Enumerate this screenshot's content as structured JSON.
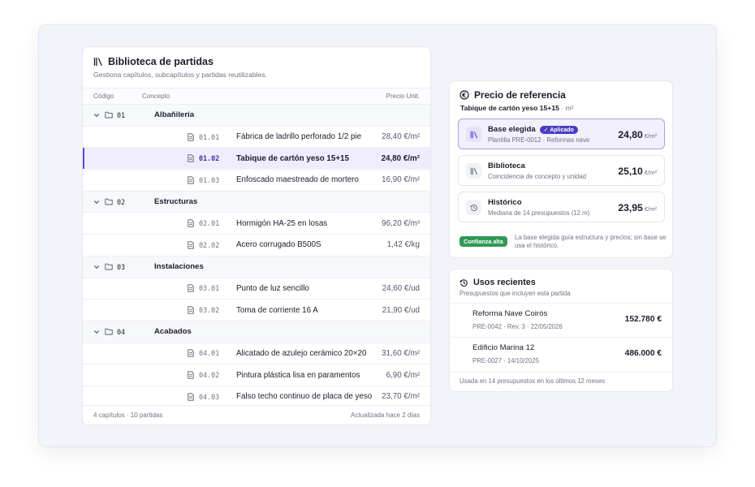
{
  "library": {
    "title": "Biblioteca de partidas",
    "subtitle": "Gestiona capítulos, subcapítulos y partidas reutilizables.",
    "columns": {
      "code": "Código",
      "concept": "Concepto",
      "price": "Precio Unit."
    },
    "chapters": [
      {
        "code": "01",
        "name": "Albañilería",
        "items": [
          {
            "code": "01.01",
            "name": "Fábrica de ladrillo perforado 1/2 pie",
            "price": "28,40 €/m²"
          },
          {
            "code": "01.02",
            "name": "Tabique de cartón yeso 15+15",
            "price": "24,80 €/m²"
          },
          {
            "code": "01.03",
            "name": "Enfoscado maestreado de mortero",
            "price": "16,90 €/m²"
          }
        ]
      },
      {
        "code": "02",
        "name": "Estructuras",
        "items": [
          {
            "code": "02.01",
            "name": "Hormigón HA-25 en losas",
            "price": "96,20 €/m³"
          },
          {
            "code": "02.02",
            "name": "Acero corrugado B500S",
            "price": "1,42 €/kg"
          }
        ]
      },
      {
        "code": "03",
        "name": "Instalaciones",
        "items": [
          {
            "code": "03.01",
            "name": "Punto de luz sencillo",
            "price": "24,60 €/ud"
          },
          {
            "code": "03.02",
            "name": "Toma de corriente 16 A",
            "price": "21,90 €/ud"
          }
        ]
      },
      {
        "code": "04",
        "name": "Acabados",
        "items": [
          {
            "code": "04.01",
            "name": "Alicatado de azulejo cerámico 20×20",
            "price": "31,60 €/m²"
          },
          {
            "code": "04.02",
            "name": "Pintura plástica lisa en paramentos",
            "price": "6,90 €/m²"
          },
          {
            "code": "04.03",
            "name": "Falso techo continuo de placa de yeso",
            "price": "23,70 €/m²"
          }
        ]
      }
    ],
    "footer_left": "4 capítulos · 10 partidas",
    "footer_right": "Actualizada hace 2 días"
  },
  "reference": {
    "title": "Precio de referencia",
    "item": "Tabique de cartón yeso 15+15",
    "unit": "· m²",
    "options": [
      {
        "name": "Base elegida",
        "badge": "✓ Aplicado",
        "desc": "Plantilla PRE-0012 · Reformas nave",
        "price": "24,80",
        "unit": "€/m²"
      },
      {
        "name": "Biblioteca",
        "desc": "Coincidencia de concepto y unidad",
        "price": "25,10",
        "unit": "€/m²"
      },
      {
        "name": "Histórico",
        "desc": "Mediana de 14 presupuestos (12 m)",
        "price": "23,95",
        "unit": "€/m²"
      }
    ],
    "confidence_badge": "Confianza alta",
    "confidence_note": "La base elegida guía estructura y precios; sin base se usa el histórico."
  },
  "recent": {
    "title": "Usos recientes",
    "subtitle": "Presupuestos que incluyen esta partida",
    "uses": [
      {
        "name": "Reforma Nave Coirós",
        "meta": "PRE-0042 · Rev. 3 · 22/05/2026",
        "amount": "152.780 €"
      },
      {
        "name": "Edificio Marina 12",
        "meta": "PRE-0027 · 14/10/2025",
        "amount": "486.000 €"
      }
    ],
    "footer": "Usada en 14 presupuestos en los últimos 12 meses"
  },
  "colors": {
    "accent": "#4b3cc4",
    "selected_bg": "#efedfb",
    "success": "#2f9a55"
  },
  "icons": {
    "library": "books-icon",
    "chapter": "folder-icon",
    "item": "document-icon",
    "reference": "euro-circle-icon",
    "history": "clock-history-icon"
  }
}
